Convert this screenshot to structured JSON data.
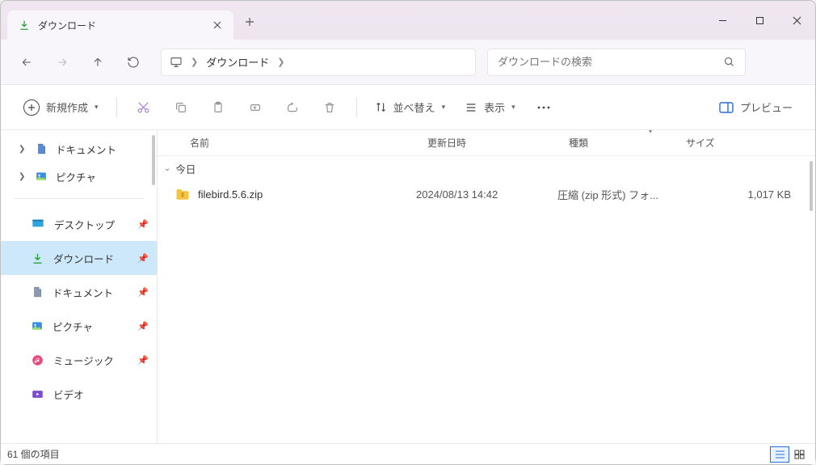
{
  "tab": {
    "title": "ダウンロード"
  },
  "breadcrumb": {
    "seg1": "ダウンロード"
  },
  "search": {
    "placeholder": "ダウンロードの検索"
  },
  "toolbar": {
    "new_label": "新規作成",
    "sort_label": "並べ替え",
    "view_label": "表示",
    "preview_label": "プレビュー"
  },
  "tree": {
    "documents": "ドキュメント",
    "pictures": "ピクチャ"
  },
  "quick": {
    "desktop": "デスクトップ",
    "downloads": "ダウンロード",
    "documents": "ドキュメント",
    "pictures": "ピクチャ",
    "music": "ミュージック",
    "video": "ビデオ"
  },
  "columns": {
    "name": "名前",
    "date": "更新日時",
    "type": "種類",
    "size": "サイズ"
  },
  "group": {
    "today": "今日"
  },
  "files": [
    {
      "name": "filebird.5.6.zip",
      "date": "2024/08/13 14:42",
      "type": "圧縮 (zip 形式) フォ...",
      "size": "1,017 KB"
    }
  ],
  "status": {
    "count": "61 個の項目"
  }
}
